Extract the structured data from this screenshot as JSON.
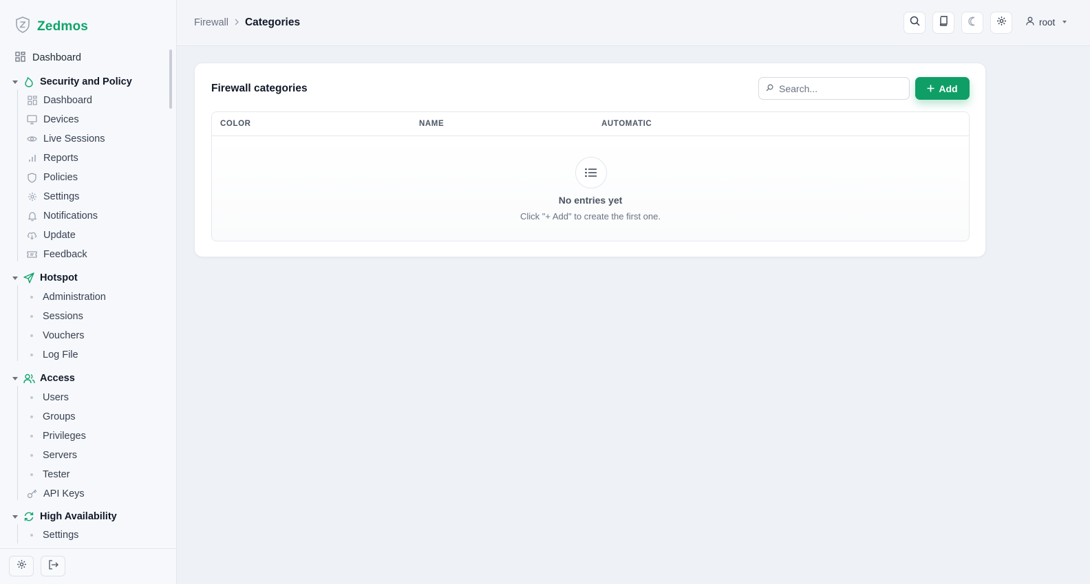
{
  "brand": {
    "name": "Zedmos",
    "accent": "#10a56b"
  },
  "sidebar": {
    "top_item": {
      "label": "Dashboard",
      "icon": "grid-icon"
    },
    "groups": [
      {
        "title": "Security and Policy",
        "icon": "flame-icon",
        "items": [
          {
            "label": "Dashboard",
            "icon": "grid-icon"
          },
          {
            "label": "Devices",
            "icon": "monitor-icon"
          },
          {
            "label": "Live Sessions",
            "icon": "eye-icon"
          },
          {
            "label": "Reports",
            "icon": "bar-chart-icon"
          },
          {
            "label": "Policies",
            "icon": "shield-icon"
          },
          {
            "label": "Settings",
            "icon": "gear-icon"
          },
          {
            "label": "Notifications",
            "icon": "bell-icon"
          },
          {
            "label": "Update",
            "icon": "cloud-download-icon"
          },
          {
            "label": "Feedback",
            "icon": "ticket-icon"
          }
        ]
      },
      {
        "title": "Hotspot",
        "icon": "send-icon",
        "items": [
          {
            "label": "Administration"
          },
          {
            "label": "Sessions"
          },
          {
            "label": "Vouchers"
          },
          {
            "label": "Log File"
          }
        ]
      },
      {
        "title": "Access",
        "icon": "users-icon",
        "items": [
          {
            "label": "Users"
          },
          {
            "label": "Groups"
          },
          {
            "label": "Privileges"
          },
          {
            "label": "Servers"
          },
          {
            "label": "Tester"
          },
          {
            "label": "API Keys",
            "icon": "key-icon"
          }
        ]
      },
      {
        "title": "High Availability",
        "icon": "refresh-icon",
        "items": [
          {
            "label": "Settings"
          }
        ]
      }
    ]
  },
  "header": {
    "breadcrumb": {
      "parent": "Firewall",
      "current": "Categories"
    },
    "user": "root"
  },
  "card": {
    "title": "Firewall categories",
    "search_placeholder": "Search...",
    "add_label": "Add",
    "columns": [
      "COLOR",
      "NAME",
      "AUTOMATIC"
    ],
    "empty_title": "No entries yet",
    "empty_subtitle": "Click \"+ Add\" to create the first one."
  }
}
